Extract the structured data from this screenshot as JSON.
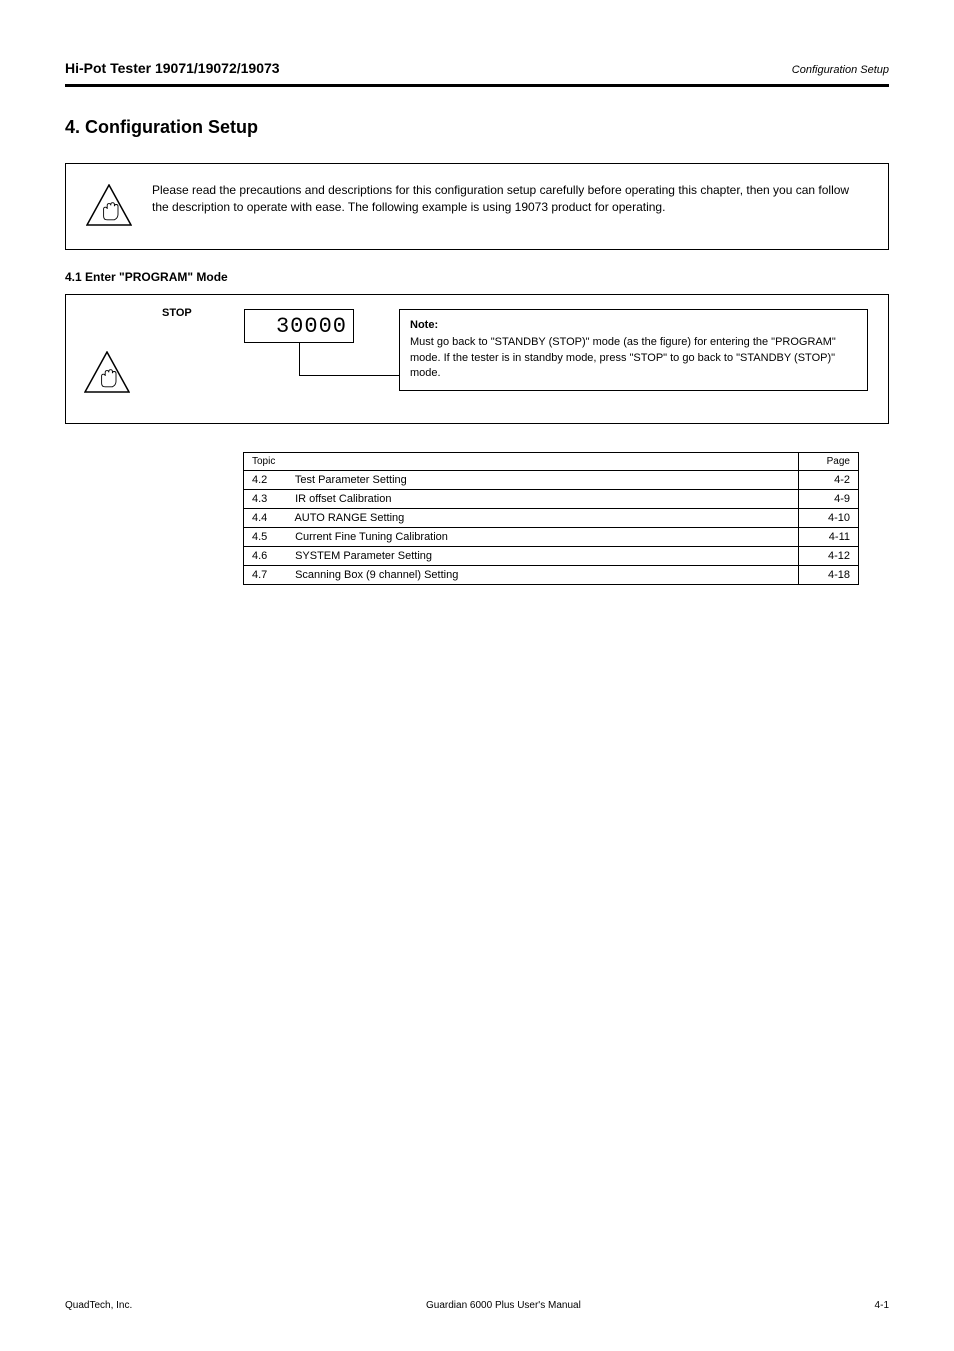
{
  "header": {
    "left": "Hi-Pot Tester 19071/19072/19073",
    "right": "Configuration Setup"
  },
  "section_title": "4.   Configuration Setup",
  "notice1": {
    "text": "Please read the precautions and descriptions for this configuration setup carefully before operating this chapter, then you can follow the description to operate with ease.  The following example is using 19073 product for operating."
  },
  "stop_section": {
    "heading": "4.1   Enter \"PROGRAM\" Mode",
    "stop_label": "STOP",
    "lcd_value": "30000",
    "note_title": "Note:",
    "note_text": "Must go back to \"STANDBY (STOP)\" mode (as the figure) for entering the \"PROGRAM\" mode. If the tester is in standby mode, press \"STOP\" to go back to \"STANDBY (STOP)\" mode."
  },
  "inner_toc": {
    "header": {
      "topic": "Topic",
      "page": "Page"
    },
    "rows": [
      {
        "num": "4.2",
        "title": "Test Parameter Setting",
        "page": "4-2"
      },
      {
        "num": "4.3",
        "title": "IR offset Calibration",
        "page": "4-9"
      },
      {
        "num": "4.4",
        "title": "AUTO RANGE Setting",
        "page": "4-10"
      },
      {
        "num": "4.5",
        "title": "Current Fine Tuning Calibration",
        "page": "4-11"
      },
      {
        "num": "4.6",
        "title": "SYSTEM Parameter Setting",
        "page": "4-12"
      },
      {
        "num": "4.7",
        "title": "Scanning Box (9 channel) Setting",
        "page": "4-18"
      }
    ]
  },
  "footer": {
    "left": "QuadTech, Inc.",
    "center": "Guardian 6000 Plus User's Manual",
    "right": "4-1"
  }
}
